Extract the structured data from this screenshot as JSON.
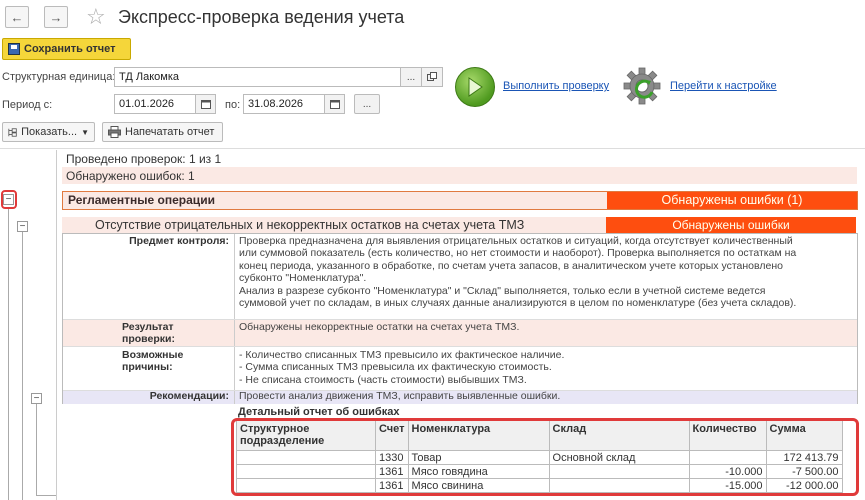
{
  "header": {
    "title": "Экспресс-проверка ведения учета",
    "back_icon": "←",
    "forward_icon": "→",
    "star_icon": "☆"
  },
  "toolbar": {
    "save_label": "Сохранить отчет",
    "show_label": "Показать...",
    "print_label": "Напечатать отчет"
  },
  "form": {
    "unit_label": "Структурная единица:",
    "unit_value": "ТД Лакомка",
    "unit_dots": "...",
    "period_label": "Период с:",
    "date_from": "01.01.2026",
    "po_label": "по:",
    "date_to": "31.08.2026",
    "period_dots": "..."
  },
  "actions": {
    "run_label": "Выполнить проверку",
    "settings_label": "Перейти к настройке"
  },
  "summary": {
    "checks": "Проведено проверок: 1 из 1",
    "errors": "Обнаружено ошибок: 1"
  },
  "section": {
    "title": "Регламентные операции",
    "status": "Обнаружены ошибки (1)"
  },
  "check": {
    "title": "Отсутствие отрицательных и некорректных остатков на счетах учета ТМЗ",
    "status": "Обнаружены ошибки",
    "subject_label": "Предмет контроля:",
    "subject_lines": [
      "Проверка предназначена для выявления отрицательных остатков и ситуаций, когда отсутствует количественный",
      "или суммовой показатель (есть количество, но нет стоимости и наоборот). Проверка выполняется по остаткам на",
      "конец периода, указанного в обработке, по счетам учета запасов, в аналитическом учете которых установлено",
      "субконто \"Номенклатура\".",
      "Анализ в разрезе субконто \"Номенклатура\" и \"Склад\" выполняется, только если в учетной системе ведется",
      "суммовой учет по складам, в иных случаях данные анализируются в целом по номенклатуре (без учета складов)."
    ],
    "result_label_1": "Результат",
    "result_label_2": "проверки:",
    "result_text": "Обнаружены некорректные остатки на счетах учета ТМЗ.",
    "causes_label_1": "Возможные",
    "causes_label_2": "причины:",
    "causes_lines": [
      "- Количество списанных ТМЗ превысило их фактическое наличие.",
      "- Сумма списанных ТМЗ превысила их фактическую стоимость.",
      "- Не списана стоимость (часть стоимости) выбывших ТМЗ."
    ],
    "recommend_label": "Рекомендации:",
    "recommend_text": "Провести анализ движения ТМЗ, исправить выявленные ошибки."
  },
  "detail": {
    "title": "Детальный отчет об ошибках",
    "columns": [
      "Структурное подразделение",
      "Счет",
      "Номенклатура",
      "Склад",
      "Количество",
      "Сумма"
    ],
    "rows": [
      [
        "",
        "1330",
        "Товар",
        "Основной склад",
        "",
        "172 413.79"
      ],
      [
        "",
        "1361",
        "Мясо говядина",
        "",
        "-10.000",
        "-7 500.00"
      ],
      [
        "",
        "1361",
        "Мясо свинина",
        "",
        "-15.000",
        "-12 000.00"
      ]
    ]
  },
  "tree": {
    "collapse_symbol": "−"
  },
  "colors": {
    "error_bar": "#fe4e0f",
    "pink_row": "#fbe9e4",
    "highlight_frame": "#e03a3a",
    "save_button": "#f5d63a"
  }
}
